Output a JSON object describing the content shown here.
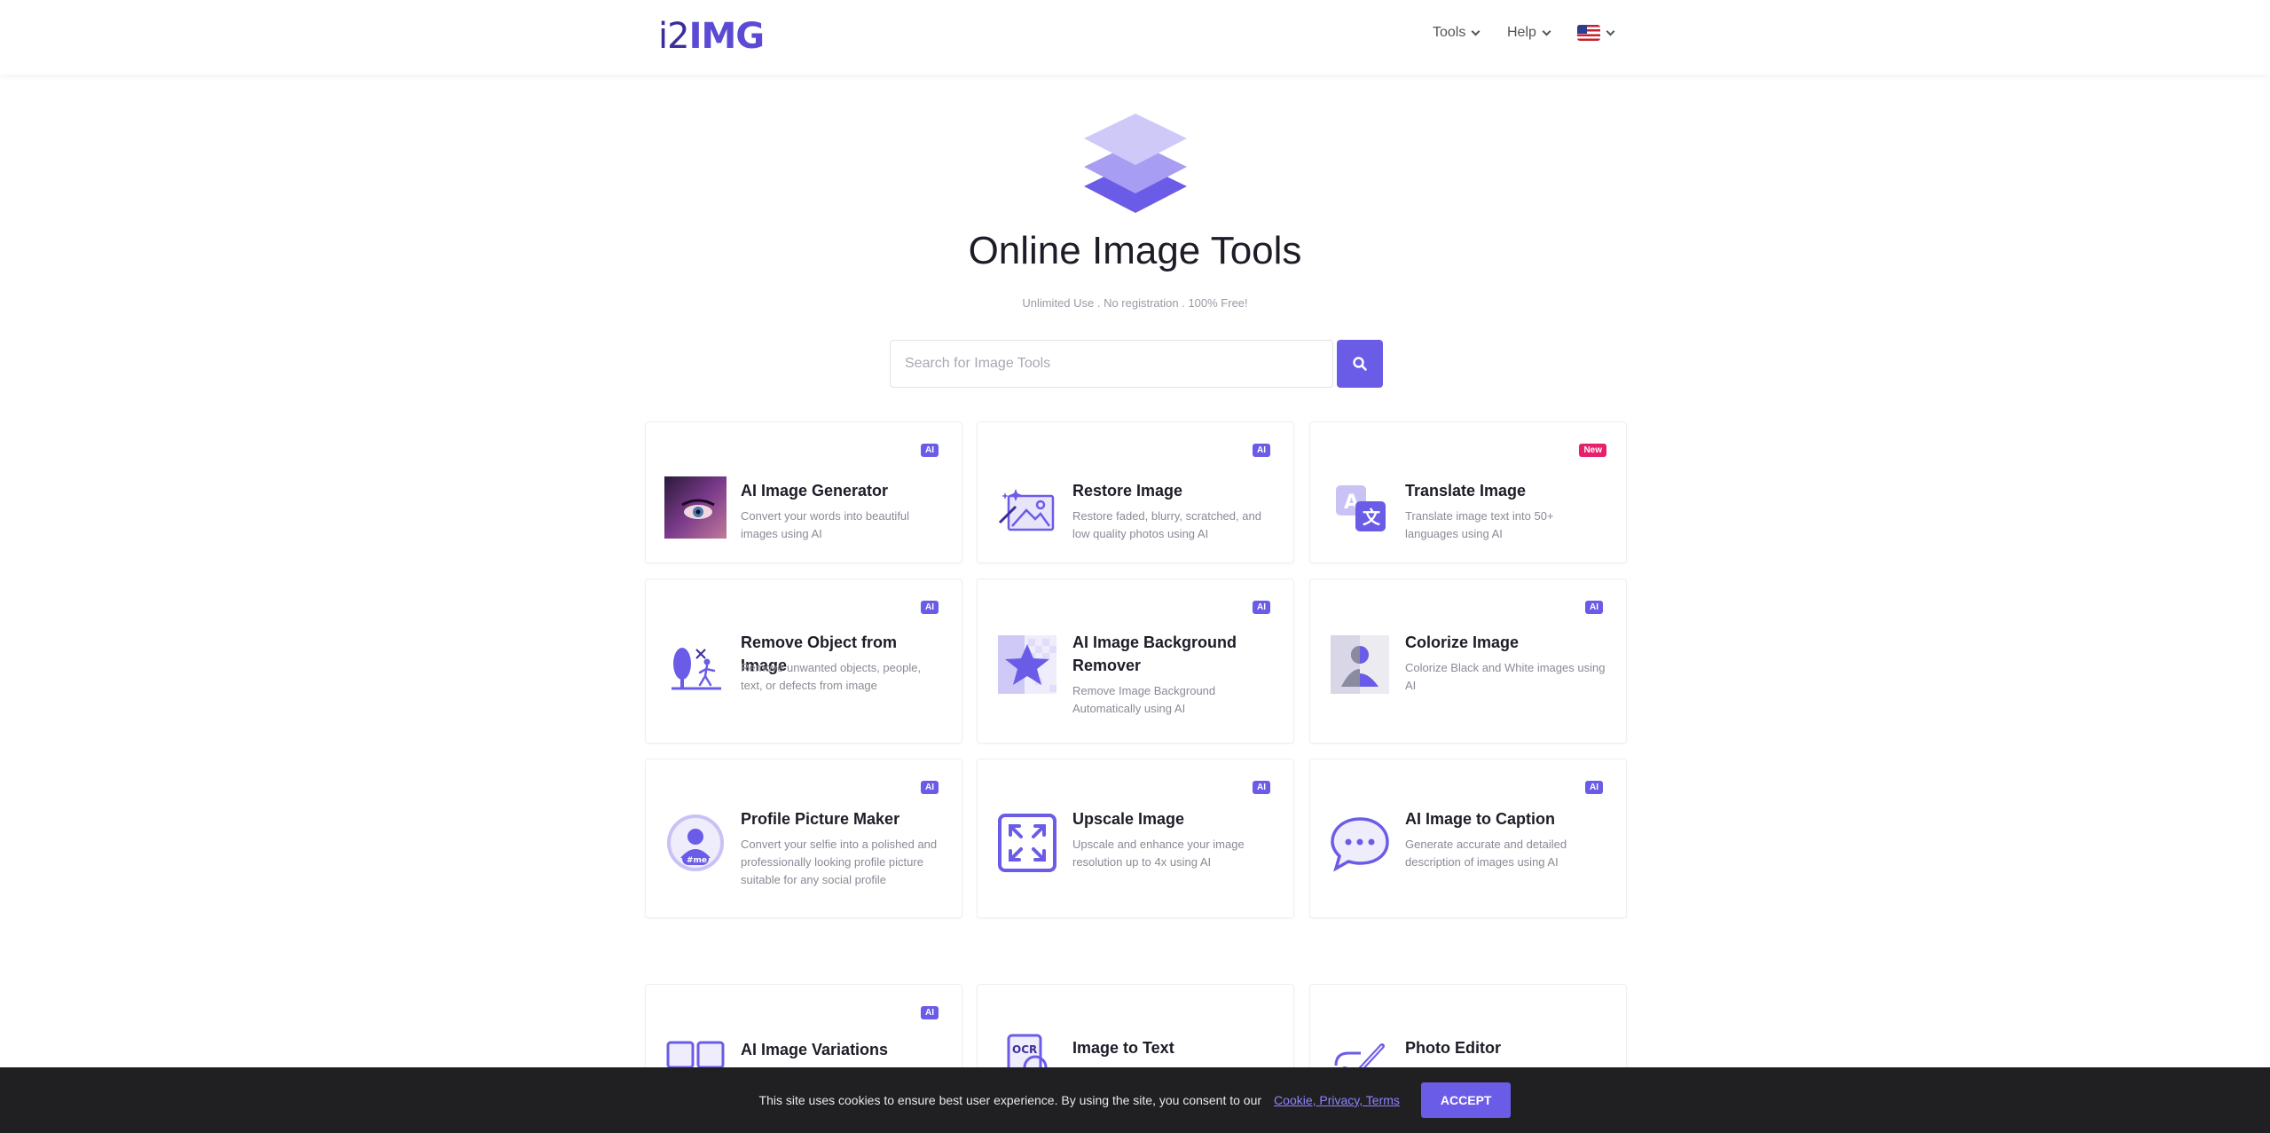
{
  "header": {
    "logo": {
      "prefix": "i2",
      "suffix": "IMG"
    },
    "nav": [
      {
        "label": "Tools"
      },
      {
        "label": "Help"
      }
    ],
    "language": "en-US"
  },
  "hero": {
    "title": "Online Image Tools",
    "subtitle": "Unlimited Use . No registration . 100% Free!"
  },
  "search": {
    "placeholder": "Search for Image Tools",
    "value": ""
  },
  "tools": [
    {
      "name": "AI Image Generator",
      "desc": "Convert your words into beautiful images using AI",
      "badge": "AI",
      "icon": "ai-portrait-icon"
    },
    {
      "name": "Restore Image",
      "desc": "Restore faded, blurry, scratched, and low quality photos using AI",
      "badge": "AI",
      "icon": "magic-wand-image-icon"
    },
    {
      "name": "Translate Image",
      "desc": "Translate image text into 50+ languages using AI",
      "badge": "New",
      "icon": "translate-icon"
    },
    {
      "name": "Remove Object from Image",
      "desc": "Remove unwanted objects, people, text, or defects from image",
      "badge": "AI",
      "icon": "remove-object-icon"
    },
    {
      "name": "AI Image Background Remover",
      "desc": "Remove Image Background Automatically using AI",
      "badge": "AI",
      "icon": "star-background-icon"
    },
    {
      "name": "Colorize Image",
      "desc": "Colorize Black and White images using AI",
      "badge": "AI",
      "icon": "person-colorize-icon"
    },
    {
      "name": "Profile Picture Maker",
      "desc": "Convert your selfie into a polished and professionally looking profile picture suitable for any social profile",
      "badge": "AI",
      "icon": "profile-picture-icon"
    },
    {
      "name": "Upscale Image",
      "desc": "Upscale and enhance your image resolution up to 4x using AI",
      "badge": "AI",
      "icon": "expand-arrows-icon"
    },
    {
      "name": "AI Image to Caption",
      "desc": "Generate accurate and detailed description of images using AI",
      "badge": "AI",
      "icon": "speech-bubble-icon"
    },
    {
      "name": "AI Image Variations",
      "desc": "",
      "badge": "AI",
      "icon": "variations-icon"
    },
    {
      "name": "Image to Text",
      "desc": "",
      "badge": "",
      "icon": "ocr-icon"
    },
    {
      "name": "Photo Editor",
      "desc": "",
      "badge": "",
      "icon": "pencil-icon"
    }
  ],
  "ocr_label": "OCR",
  "hashtag": "#me",
  "cookie": {
    "text": "This site uses cookies to ensure best user experience. By using the site, you consent to our",
    "links": "Cookie, Privacy, Terms",
    "accept": "ACCEPT"
  },
  "colors": {
    "accent": "#6b5ce7",
    "new_badge": "#e6206a",
    "cookie_bg": "#202022"
  }
}
